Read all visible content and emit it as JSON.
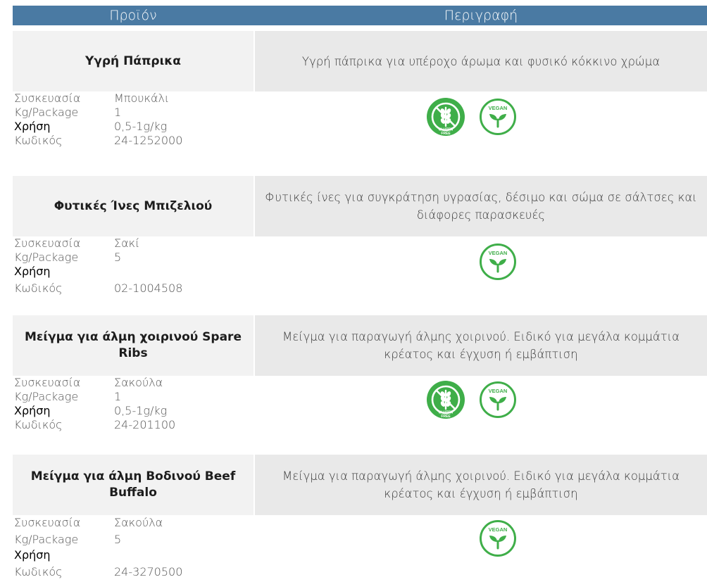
{
  "header": {
    "col1": "Προϊόν",
    "col2": "Περιγραφή"
  },
  "attribute_labels": {
    "packaging": "Συσκευασία",
    "kg_package": "Kg/Package",
    "usage": "Χρήση",
    "code": "Κωδικός"
  },
  "badges": {
    "gluten_free_text_1": "GLUTEN",
    "gluten_free_text_2": "FREE",
    "vegan_text": "VEGAN",
    "green": "#3fae49"
  },
  "products": [
    {
      "name": "Υγρή Πάπρικα",
      "description": "Υγρή πάπρικα για υπέροχο άρωμα και φυσικό κόκκινο χρώμα",
      "packaging": "Μπουκάλι",
      "kg_package": "1",
      "usage": "0,5-1g/kg",
      "code": "24-1252000",
      "icons": [
        "gluten-free",
        "vegan"
      ]
    },
    {
      "name": "Φυτικές Ίνες Μπιζελιού",
      "description": "Φυτικές ίνες για συγκράτηση υγρασίας, δέσιμο και σώμα σε σάλτσες και διάφορες παρασκευές",
      "packaging": "Σακί",
      "kg_package": "5",
      "usage": "",
      "code": "02-1004508",
      "icons": [
        "vegan"
      ]
    },
    {
      "name": "Μείγμα για άλμη χοιρινού Spare Ribs",
      "description": "Μείγμα για παραγωγή άλμης χοιρινού. Ειδικό για μεγάλα κομμάτια κρέατος και έγχυση ή εμβάπτιση",
      "packaging": "Σακούλα",
      "kg_package": "1",
      "usage": "0,5-1g/kg",
      "code": "24-201100",
      "icons": [
        "gluten-free",
        "vegan"
      ]
    },
    {
      "name": "Μείγμα για άλμη Βοδινού Beef Buffalo",
      "description": "Μείγμα για παραγωγή άλμης χοιρινού. Ειδικό για μεγάλα κομμάτια κρέατος και έγχυση ή εμβάπτιση",
      "packaging": "Σακούλα",
      "kg_package": "5",
      "usage": "",
      "code": "24-3270500",
      "icons": [
        "vegan"
      ]
    }
  ]
}
